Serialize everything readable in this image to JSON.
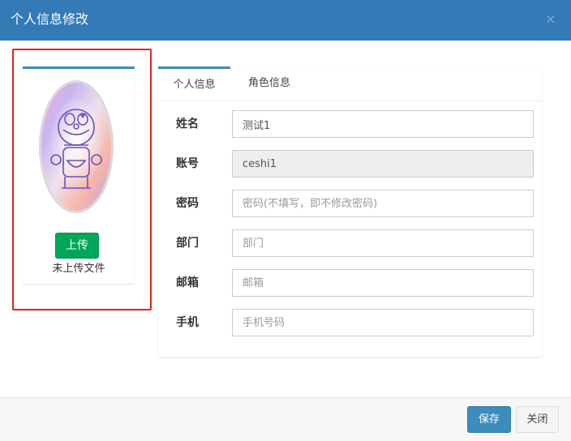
{
  "dialog": {
    "title": "个人信息修改",
    "close_glyph": "×"
  },
  "avatar": {
    "image_description": "cartoon robot cat avatar",
    "upload_label": "上传",
    "upload_status": "未上传文件"
  },
  "tabs": [
    {
      "label": "个人信息",
      "active": true
    },
    {
      "label": "角色信息",
      "active": false
    }
  ],
  "form": {
    "name": {
      "label": "姓名",
      "value": "测试1",
      "placeholder": ""
    },
    "account": {
      "label": "账号",
      "value": "ceshi1",
      "placeholder": ""
    },
    "password": {
      "label": "密码",
      "value": "",
      "placeholder": "密码(不填写，即不修改密码)"
    },
    "department": {
      "label": "部门",
      "value": "",
      "placeholder": "部门"
    },
    "email": {
      "label": "邮箱",
      "value": "",
      "placeholder": "邮箱"
    },
    "phone": {
      "label": "手机",
      "value": "",
      "placeholder": "手机号码"
    }
  },
  "footer": {
    "save_label": "保存",
    "close_label": "关闭"
  },
  "colors": {
    "header": "#337ab7",
    "highlight_border": "#e0261f",
    "upload_button": "#00a65a",
    "save_button": "#3c8dbc"
  }
}
